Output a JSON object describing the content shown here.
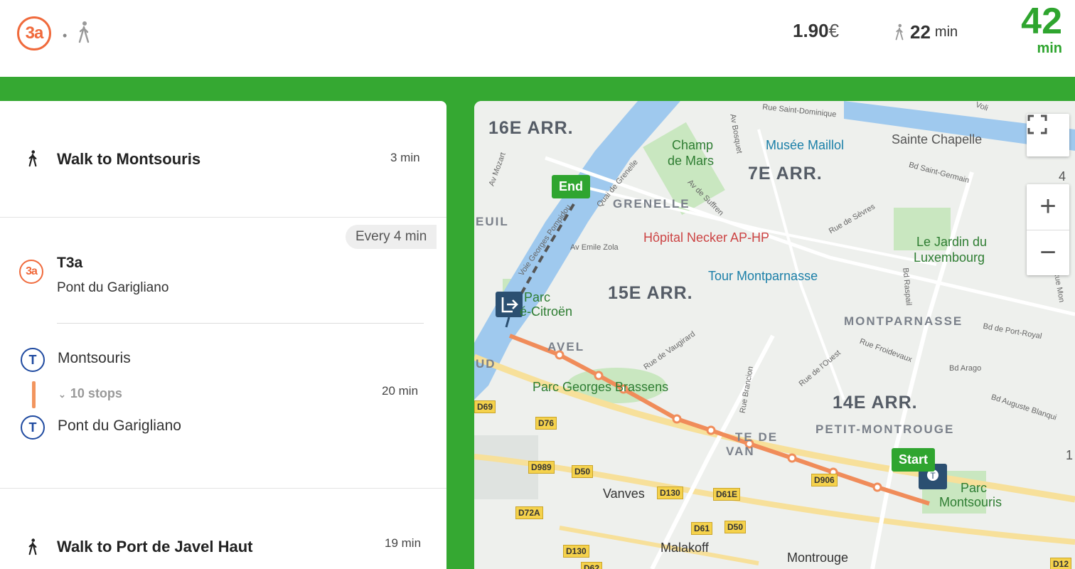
{
  "header": {
    "line_badge": "3a",
    "separator": "•",
    "walk_icon": "walk-icon",
    "price": "1.90",
    "currency": "€",
    "walk_minutes": "22",
    "walk_unit": "min",
    "total_minutes": "42",
    "total_unit": "min"
  },
  "steps": {
    "walk1": {
      "title": "Walk to Montsouris",
      "time": "3 min"
    },
    "transit": {
      "frequency": "Every 4 min",
      "badge": "3a",
      "line": "T3a",
      "direction": "Pont du Garigliano",
      "tram_icon": "T",
      "from_stop": "Montsouris",
      "stops_toggle": "10 stops",
      "to_stop": "Pont du Garigliano",
      "time": "20 min"
    },
    "walk2": {
      "title": "Walk to Port de Javel Haut",
      "time": "19 min"
    }
  },
  "map": {
    "end_label": "End",
    "start_label": "Start",
    "controls": {
      "fullscreen": "fullscreen-icon",
      "zoom_in": "+",
      "zoom_out": "−"
    },
    "districts": [
      "16E ARR.",
      "7E ARR.",
      "15E ARR.",
      "14E ARR."
    ],
    "neighborhoods": [
      "GRENELLE",
      "MONTPARNASSE",
      "PETIT-MONTROUGE",
      "AVEL",
      "TE DE",
      "VAN"
    ],
    "pois": [
      "Champ",
      "de Mars",
      "Musée Maillol",
      "Sainte Chapelle",
      "Hôpital Necker AP-HP",
      "Le Jardin du",
      "Luxembourg",
      "Tour Montparnasse",
      "Parc",
      "é-Citroën",
      "Parc Georges Brassens",
      "Parc",
      "Montsouris",
      "Vanves",
      "Malakoff",
      "Montrouge",
      "EUIL",
      "UD"
    ],
    "streets": [
      "Rue Saint-Dominique",
      "Av Bosquet",
      "Av Mozart",
      "Quai de Grenelle",
      "Av de Suffren",
      "Rue de Sèvres",
      "Bd Saint-Germain",
      "Voie Georges Pompidou",
      "Av Emile Zola",
      "Bd Raspail",
      "Rue de Vaugirard",
      "Rue Froidevaux",
      "Bd de Port-Royal",
      "Rue de l'Ouest",
      "Bd Arago",
      "Rue Brancion",
      "Bd Auguste Blanqui",
      "Rue Mon",
      "Voli"
    ],
    "road_badges": [
      "D69",
      "D76",
      "D989",
      "D50",
      "D130",
      "D61E",
      "D72A",
      "D61",
      "D50",
      "D130",
      "D906",
      "D62",
      "D12"
    ],
    "partial": "4",
    "partial2": "1"
  },
  "colors": {
    "accent_green": "#35a832",
    "tram_orange": "#f06a3c",
    "tram_blue": "#1f4aa0"
  }
}
